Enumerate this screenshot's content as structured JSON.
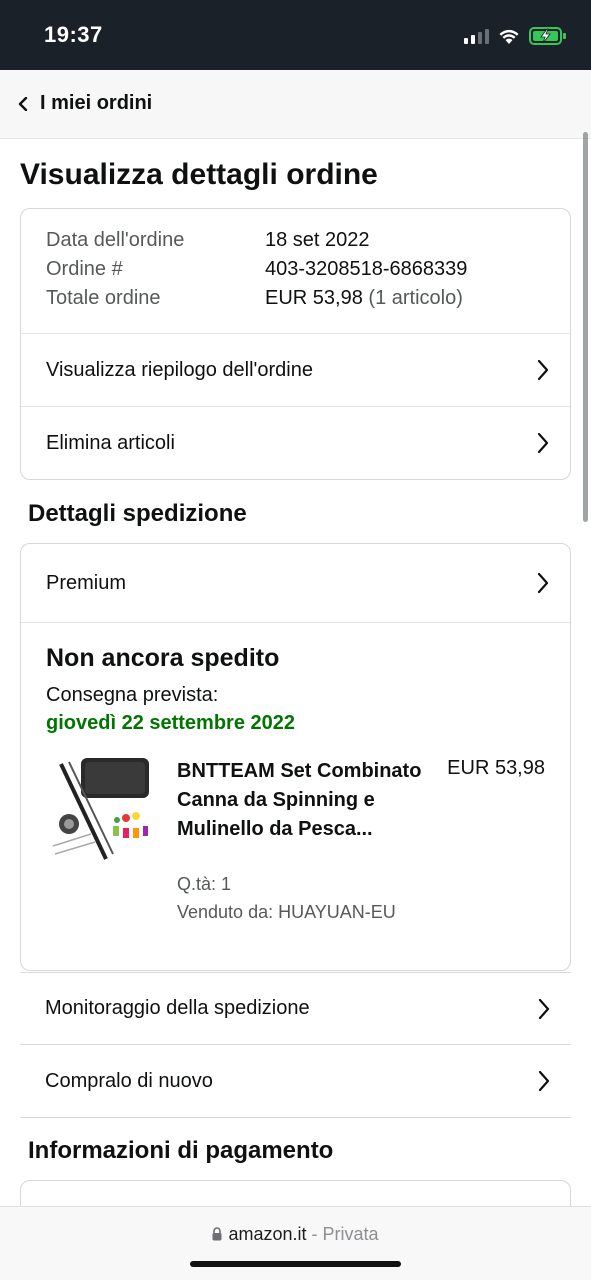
{
  "status_bar": {
    "time": "19:37"
  },
  "nav": {
    "back_label": "I miei ordini"
  },
  "page_title": "Visualizza dettagli ordine",
  "order_info": [
    {
      "label": "Data dell'ordine",
      "value": "18 set 2022",
      "extra": ""
    },
    {
      "label": "Ordine #",
      "value": "403-3208518-6868339",
      "extra": ""
    },
    {
      "label": "Totale ordine",
      "value": "EUR 53,98",
      "extra": "(1 articolo)"
    }
  ],
  "summary_links": {
    "view_summary": "Visualizza riepilogo dell'ordine",
    "delete_items": "Elimina articoli"
  },
  "shipping": {
    "section_title": "Dettagli spedizione",
    "premium_label": "Premium",
    "status": "Non ancora spedito",
    "delivery_label": "Consegna prevista:",
    "delivery_date": "giovedì 22 settembre 2022",
    "delivery_color": "#007600",
    "product": {
      "title": "BNTTEAM Set Combinato Canna da Spinning e Mulinello da Pesca...",
      "price": "EUR 53,98",
      "qty": "Q.tà: 1",
      "seller": "Venduto da: HUAYUAN-EU"
    },
    "track_label": "Monitoraggio della spedizione",
    "buy_again_label": "Compralo di nuovo"
  },
  "payment": {
    "section_title": "Informazioni di pagamento"
  },
  "browser": {
    "domain": "amazon.it",
    "separator": "-",
    "mode": "Privata"
  }
}
